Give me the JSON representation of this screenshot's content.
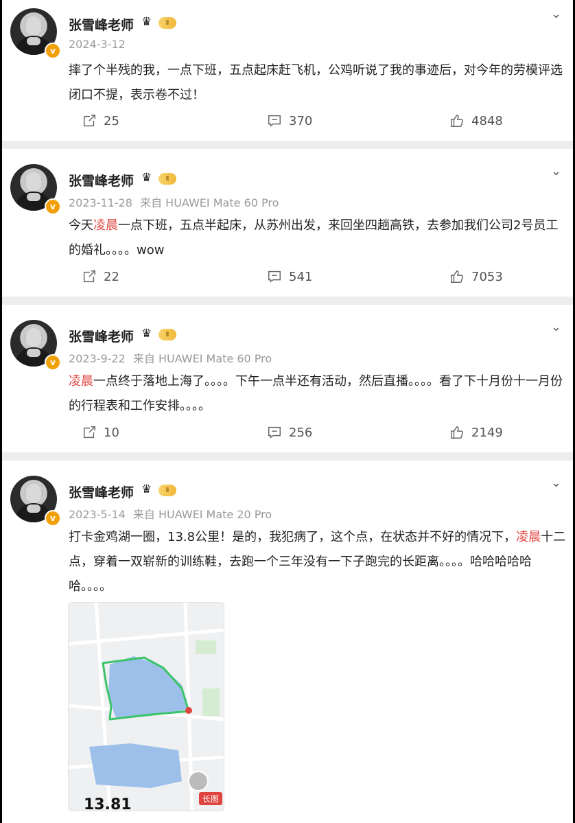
{
  "posts": [
    {
      "author": "张雪峰老师",
      "level": "Ⅱ",
      "date": "2024-3-12",
      "source": "",
      "text_parts": [
        {
          "t": "摔了个半残的我，一点下班，五点起床赶飞机，公鸡听说了我的事迹后，对今年的劳模评选闭口不提，表示卷不过！",
          "hl": false
        }
      ],
      "reposts": "25",
      "comments": "370",
      "likes": "4848"
    },
    {
      "author": "张雪峰老师",
      "level": "Ⅱ",
      "date": "2023-11-28",
      "source": "来自 HUAWEI Mate 60 Pro",
      "text_parts": [
        {
          "t": "今天",
          "hl": false
        },
        {
          "t": "凌晨",
          "hl": true
        },
        {
          "t": "一点下班，五点半起床，从苏州出发，来回坐四趟高铁，去参加我们公司2号员工的婚礼。。。。wow",
          "hl": false
        }
      ],
      "reposts": "22",
      "comments": "541",
      "likes": "7053"
    },
    {
      "author": "张雪峰老师",
      "level": "Ⅱ",
      "date": "2023-9-22",
      "source": "来自 HUAWEI Mate 60 Pro",
      "text_parts": [
        {
          "t": "凌晨",
          "hl": true
        },
        {
          "t": "一点终于落地上海了。。。。下午一点半还有活动，然后直播。。。。看了下十月份十一月份的行程表和工作安排。。。。",
          "hl": false
        }
      ],
      "reposts": "10",
      "comments": "256",
      "likes": "2149"
    },
    {
      "author": "张雪峰老师",
      "level": "Ⅱ",
      "date": "2023-5-14",
      "source": "来自 HUAWEI Mate 20 Pro",
      "text_parts": [
        {
          "t": "打卡金鸡湖一圈，13.8公里！是的，我犯病了，这个点，在状态并不好的情况下，",
          "hl": false
        },
        {
          "t": "凌晨",
          "hl": true
        },
        {
          "t": "十二点，穿着一双崭新的训练鞋，去跑一个三年没有一下子跑完的长距离。。。。哈哈哈哈哈哈。。。。",
          "hl": false
        }
      ],
      "image": {
        "badge": "长图",
        "distance": "13.81"
      }
    }
  ],
  "icons": {
    "verified": "verified-v-badge",
    "crown": "vip-crown-icon",
    "more": "chevron-down-icon",
    "repost": "repost-icon",
    "comment": "comment-icon",
    "like": "thumbs-up-icon"
  },
  "colors": {
    "highlight": "#e0443f",
    "verified": "#f2a007",
    "route": "#3cc46a",
    "lake": "#8fb6e6"
  }
}
